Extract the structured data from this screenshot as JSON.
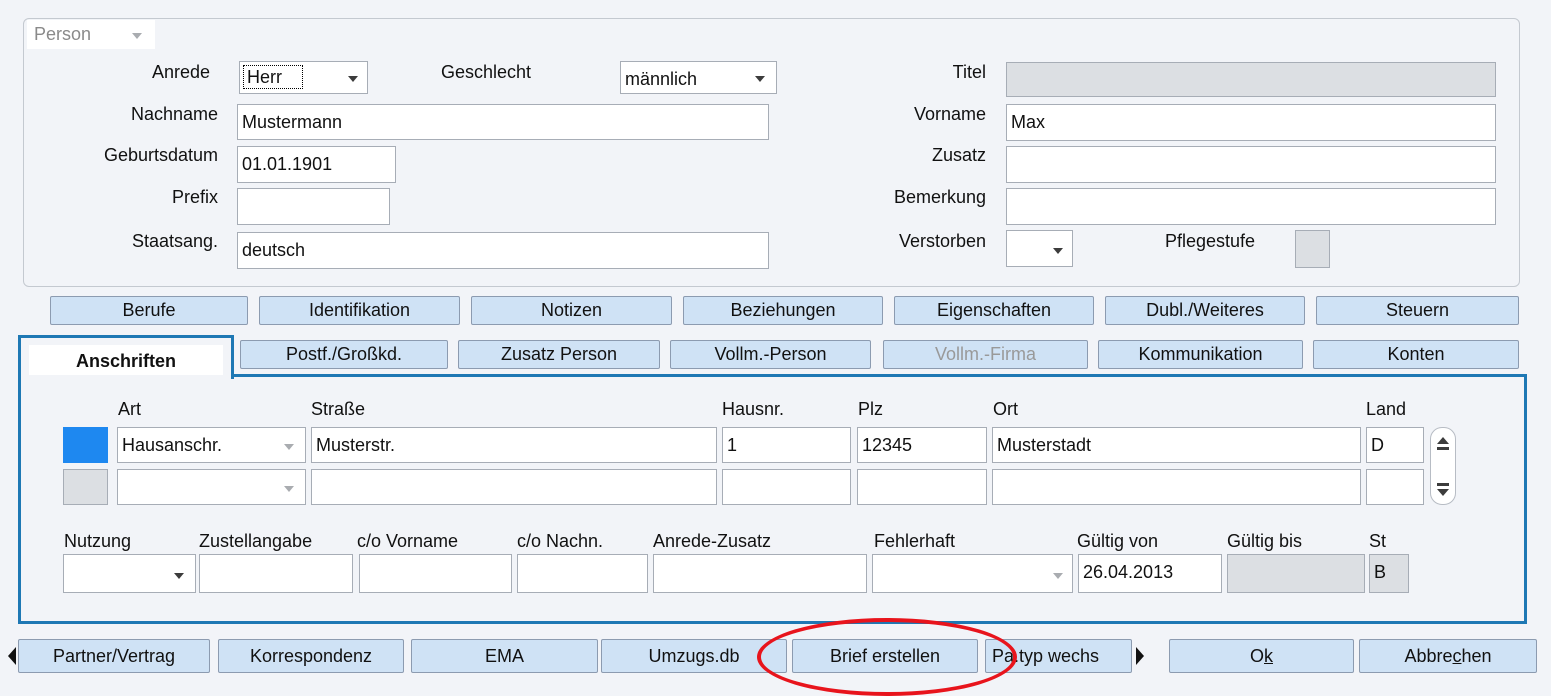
{
  "person_group": {
    "selector_value": "Person",
    "anrede_label": "Anrede",
    "anrede_value": "Herr",
    "geschlecht_label": "Geschlecht",
    "geschlecht_value": "männlich",
    "titel_label": "Titel",
    "titel_value": "",
    "nachname_label": "Nachname",
    "nachname_value": "Mustermann",
    "vorname_label": "Vorname",
    "vorname_value": "Max",
    "geburtsdatum_label": "Geburtsdatum",
    "geburtsdatum_value": "01.01.1901",
    "zusatz_label": "Zusatz",
    "zusatz_value": "",
    "prefix_label": "Prefix",
    "prefix_value": "",
    "bemerkung_label": "Bemerkung",
    "bemerkung_value": "",
    "staatsang_label": "Staatsang.",
    "staatsang_value": "deutsch",
    "verstorben_label": "Verstorben",
    "verstorben_value": "",
    "pflegestufe_label": "Pflegestufe"
  },
  "tabs_row1": [
    "Berufe",
    "Identifikation",
    "Notizen",
    "Beziehungen",
    "Eigenschaften",
    "Dubl./Weiteres",
    "Steuern"
  ],
  "tabs_row2": {
    "active": "Anschriften",
    "others": [
      "Postf./Großkd.",
      "Zusatz Person",
      "Vollm.-Person",
      "Vollm.-Firma",
      "Kommunikation",
      "Konten"
    ]
  },
  "address": {
    "headers": {
      "art": "Art",
      "strasse": "Straße",
      "hausnr": "Hausnr.",
      "plz": "Plz",
      "ort": "Ort",
      "land": "Land"
    },
    "rows": [
      {
        "art": "Hausanschr.",
        "strasse": "Musterstr.",
        "hausnr": "1",
        "plz": "12345",
        "ort": "Musterstadt",
        "land": "D"
      },
      {
        "art": "",
        "strasse": "",
        "hausnr": "",
        "plz": "",
        "ort": "",
        "land": ""
      }
    ],
    "detail_headers": {
      "nutzung": "Nutzung",
      "zustellangabe": "Zustellangabe",
      "co_vorname": "c/o Vorname",
      "co_nachname": "c/o Nachn.",
      "anrede_zusatz": "Anrede-Zusatz",
      "fehlerhaft": "Fehlerhaft",
      "gueltig_von": "Gültig von",
      "gueltig_bis": "Gültig bis",
      "st": "St"
    },
    "detail_values": {
      "nutzung": "",
      "zustellangabe": "",
      "co_vorname": "",
      "co_nachname": "",
      "anrede_zusatz": "",
      "fehlerhaft": "",
      "gueltig_von": "26.04.2013",
      "gueltig_bis": "",
      "st": "B"
    }
  },
  "bottom_buttons": {
    "partner_vertrag": "Partner/Vertrag",
    "korrespondenz": "Korrespondenz",
    "ema": "EMA",
    "umzugs_db": "Umzugs.db",
    "brief_erstellen": "Brief erstellen",
    "pa_typ": "Pa.typ wechs",
    "ok_prefix": "O",
    "ok_underlined": "k",
    "ok_suffix": "",
    "abbrechen_prefix": "Abbre",
    "abbrechen_underlined": "c",
    "abbrechen_suffix": "hen"
  },
  "colors": {
    "panel_border": "#1e78b4",
    "button_bg": "#cfe2f5",
    "selected_row_marker": "#1e88f0",
    "highlight_circle": "#e8141c"
  }
}
